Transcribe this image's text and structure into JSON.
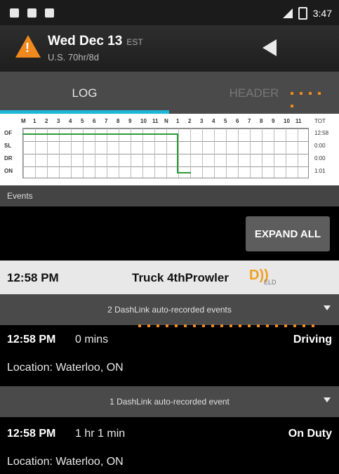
{
  "status_bar": {
    "time": "3:47",
    "icons": [
      "notification-icon",
      "lock-icon",
      "android-icon"
    ]
  },
  "app_bar": {
    "date": "Wed Dec 13",
    "timezone": "EST",
    "ruleset": "U.S. 70hr/8d",
    "icons": [
      "warning-icon",
      "back-icon"
    ]
  },
  "tabs": {
    "log": "LOG",
    "header": "HEADER"
  },
  "log_grid": {
    "hours": [
      "M",
      "1",
      "2",
      "3",
      "4",
      "5",
      "6",
      "7",
      "8",
      "9",
      "10",
      "11",
      "N",
      "1",
      "2",
      "3",
      "4",
      "5",
      "6",
      "7",
      "8",
      "9",
      "10",
      "11"
    ],
    "rows": [
      "OF",
      "SL",
      "DR",
      "ON"
    ],
    "tot_label": "TOT",
    "totals": [
      "12:58",
      "0:00",
      "0:00",
      "1:01"
    ],
    "line_color": "#2e9b3c"
  },
  "events_label": "Events",
  "expand_all_label": "EXPAND ALL",
  "vehicle_row": {
    "time": "12:58 PM",
    "vehicle": "Truck 4thProwler",
    "eld": "ELD"
  },
  "groups": [
    {
      "label": "2 DashLink auto-recorded events"
    },
    {
      "label": "1 DashLink auto-recorded event"
    }
  ],
  "events": [
    {
      "time": "12:58 PM",
      "duration": "0 mins",
      "status": "Driving",
      "location_label": "Location:",
      "location": "Waterloo, ON"
    },
    {
      "time": "12:58 PM",
      "duration": "1 hr 1 min",
      "status": "On Duty",
      "location_label": "Location:",
      "location": "Waterloo, ON"
    }
  ],
  "colors": {
    "accent": "#1eb6d8",
    "warning": "#f08a1e"
  }
}
